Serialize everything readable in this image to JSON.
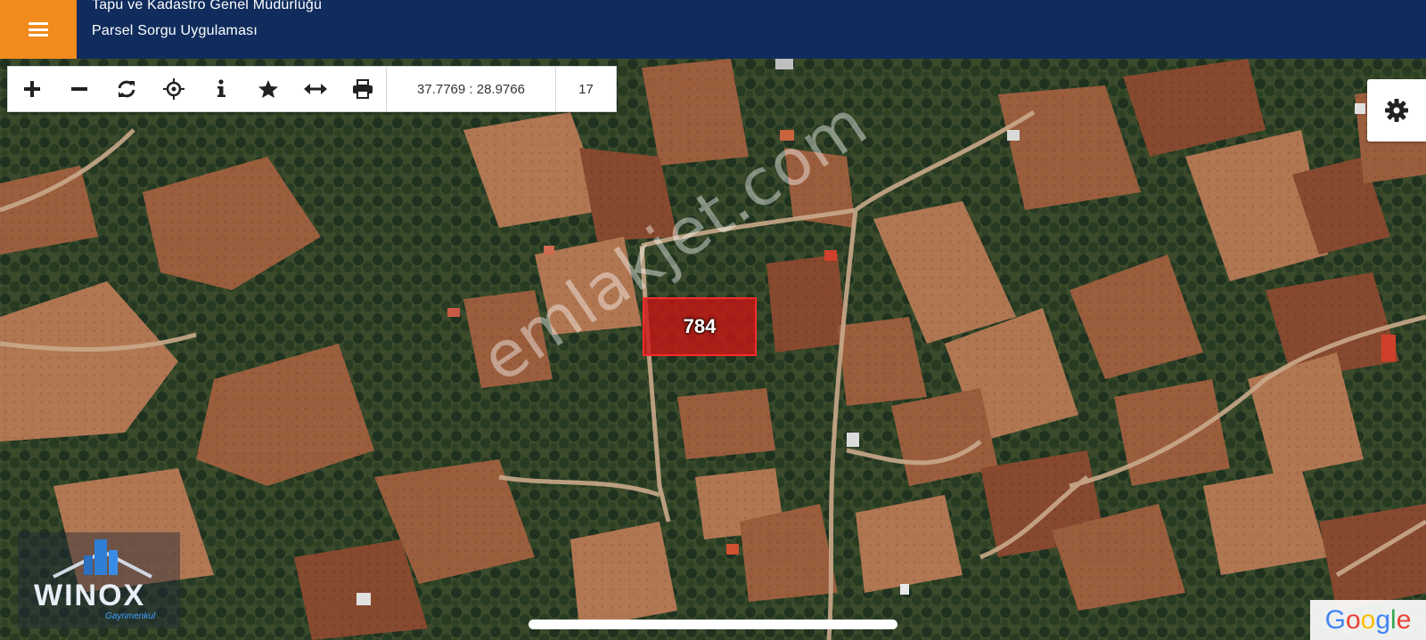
{
  "header": {
    "title_line1": "Tapu ve Kadastro Genel Müdürlüğü",
    "title_line2": "Parsel Sorgu Uygulaması",
    "menu_icon": "hamburger-menu-icon"
  },
  "toolbar": {
    "tools": [
      {
        "name": "zoom-in",
        "icon": "plus-icon"
      },
      {
        "name": "zoom-out",
        "icon": "minus-icon"
      },
      {
        "name": "refresh",
        "icon": "refresh-icon"
      },
      {
        "name": "locate",
        "icon": "crosshair-icon"
      },
      {
        "name": "info",
        "icon": "info-icon"
      },
      {
        "name": "favorite",
        "icon": "star-icon"
      },
      {
        "name": "measure",
        "icon": "arrows-horizontal-icon"
      },
      {
        "name": "print",
        "icon": "print-icon"
      }
    ],
    "coordinates": "37.7769 : 28.9766",
    "zoom_level": "17"
  },
  "settings_icon": "gear-icon",
  "parcel": {
    "number": "784"
  },
  "watermark": "emlakjet.com",
  "logo": {
    "name": "WINOX",
    "subtitle": "Gayrimenkul"
  },
  "attribution": "Google",
  "colors": {
    "header": "#0f2c5c",
    "menu_button": "#f28b1e",
    "parcel_fill": "#cd1414"
  }
}
